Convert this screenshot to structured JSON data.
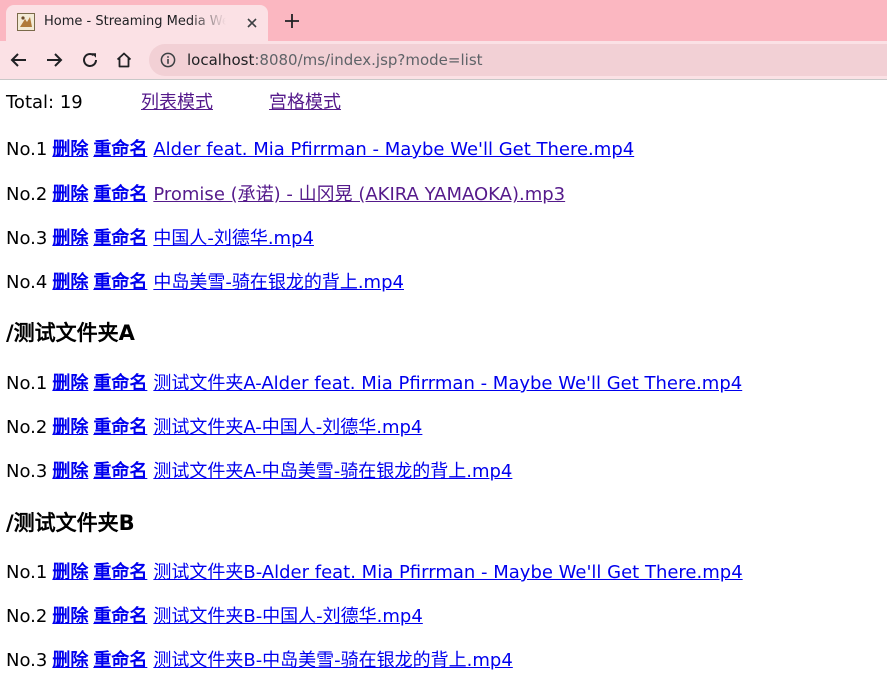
{
  "browser": {
    "tab_title": "Home - Streaming Media Web Se",
    "url_host": "localhost",
    "url_rest": ":8080/ms/index.jsp?mode=list"
  },
  "page": {
    "total_label": "Total: 19",
    "list_mode_link": "列表模式",
    "grid_mode_link": "宫格模式",
    "delete_label": "删除",
    "rename_label": "重命名"
  },
  "root_files": [
    {
      "no": "No.1",
      "name": "Alder feat. Mia Pfirrman - Maybe We'll Get There.mp4"
    },
    {
      "no": "No.2",
      "name": "Promise (承诺) - 山冈晃 (AKIRA YAMAOKA).mp3"
    },
    {
      "no": "No.3",
      "name": "中国人-刘德华.mp4"
    },
    {
      "no": "No.4",
      "name": "中岛美雪-骑在银龙的背上.mp4"
    }
  ],
  "folders": [
    {
      "title": "/测试文件夹A",
      "files": [
        {
          "no": "No.1",
          "name": "测试文件夹A-Alder feat. Mia Pfirrman - Maybe We'll Get There.mp4"
        },
        {
          "no": "No.2",
          "name": "测试文件夹A-中国人-刘德华.mp4"
        },
        {
          "no": "No.3",
          "name": "测试文件夹A-中岛美雪-骑在银龙的背上.mp4"
        }
      ]
    },
    {
      "title": "/测试文件夹B",
      "files": [
        {
          "no": "No.1",
          "name": "测试文件夹B-Alder feat. Mia Pfirrman - Maybe We'll Get There.mp4"
        },
        {
          "no": "No.2",
          "name": "测试文件夹B-中国人-刘德华.mp4"
        },
        {
          "no": "No.3",
          "name": "测试文件夹B-中岛美雪-骑在银龙的背上.mp4"
        }
      ]
    }
  ],
  "colors": {
    "tabstrip": "#fbb7c1",
    "toolbar": "#fbe1e5",
    "link": "#0000ee",
    "visited_link": "#551a8b"
  }
}
